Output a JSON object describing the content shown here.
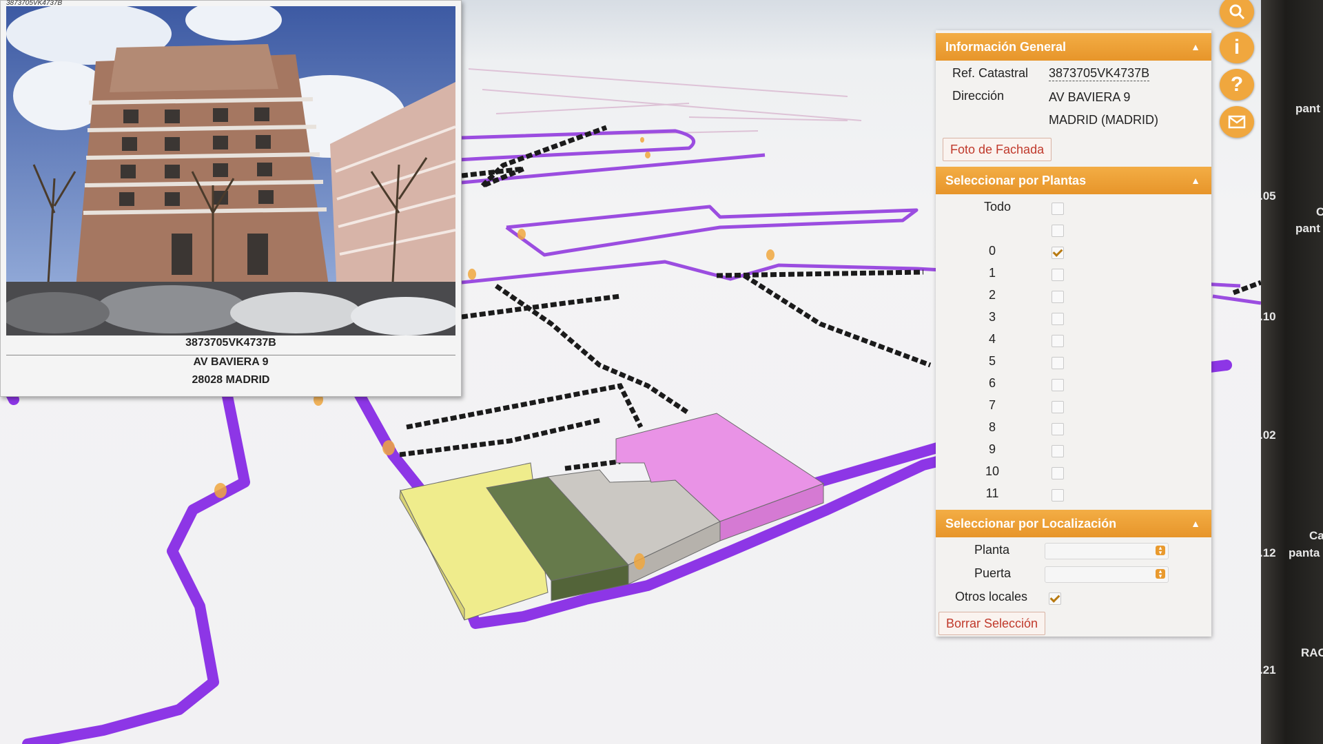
{
  "facade_popup": {
    "small_ref": "3873705VK4737B",
    "ref": "3873705VK4737B",
    "address_line1": "AV BAVIERA 9",
    "address_line2": "28028 MADRID"
  },
  "toolbar": {
    "search_icon": "search-icon",
    "info_icon": "info-icon",
    "help_icon": "help-icon",
    "mail_icon": "mail-icon",
    "info_glyph": "i",
    "help_glyph": "?"
  },
  "info_general": {
    "title": "Información General",
    "ref_label": "Ref. Catastral",
    "ref_value": "3873705VK4737B",
    "dir_label": "Dirección",
    "dir_line1": "AV BAVIERA 9",
    "dir_line2": "MADRID (MADRID)",
    "foto_button": "Foto de Fachada"
  },
  "plantas": {
    "title": "Seleccionar por Plantas",
    "todo_label": "Todo",
    "floors": [
      "0",
      "1",
      "2",
      "3",
      "4",
      "5",
      "6",
      "7",
      "8",
      "9",
      "10",
      "11"
    ],
    "checked": "0"
  },
  "localizacion": {
    "title": "Seleccionar por Localización",
    "planta_label": "Planta",
    "planta_value": "",
    "puerta_label": "Puerta",
    "puerta_value": "",
    "otros_label": "Otros locales",
    "otros_checked": true,
    "borrar_button": "Borrar Selección"
  },
  "right_strip": {
    "labels": [
      "pant",
      ".05",
      "C",
      "pant",
      ".10",
      ".02",
      "Ca",
      ".12",
      "panta",
      "RAC",
      ".21"
    ]
  },
  "colors": {
    "accent": "#f0a73e",
    "parcel_line": "#9b4de0",
    "building_yellow": "#efec8c",
    "building_green": "#667a4b",
    "building_grey": "#cbc8c3",
    "building_pink": "#e993e6"
  }
}
